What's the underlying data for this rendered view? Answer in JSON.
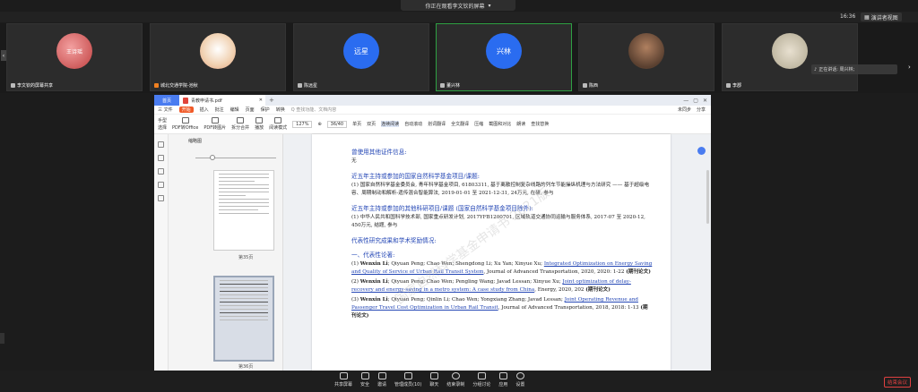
{
  "banner": {
    "text": "你正在观看李文钦的屏幕"
  },
  "topbar": {
    "time": "16:36",
    "layout_label": "演讲者视图"
  },
  "participants": [
    {
      "name": "李文钦的屏幕共享",
      "avatar": "photo",
      "avatar_text": "王诗瑶"
    },
    {
      "name": "城北交通学院-池秋",
      "avatar": "photo",
      "avatar_text": ""
    },
    {
      "name": "陈远星",
      "avatar": "initials",
      "avatar_text": "远星"
    },
    {
      "name": "董兴林",
      "avatar": "initials",
      "avatar_text": "兴林"
    },
    {
      "name": "陈西",
      "avatar": "photo",
      "avatar_text": ""
    },
    {
      "name": "李郡",
      "avatar": "photo",
      "avatar_text": ""
    }
  ],
  "speaking": {
    "text": "正在讲话: 周兴林;"
  },
  "wps": {
    "home_tab": "首页",
    "doc_tab": "青教申请书.pdf",
    "menus": [
      "三 文件",
      "开始",
      "插入",
      "批注",
      "编辑",
      "页面",
      "保护",
      "转换"
    ],
    "search_hint": "Q 查找功能、文档内容",
    "menu_right": [
      "未同步",
      "分享"
    ],
    "tools_left": [
      "手型",
      "选择"
    ],
    "tools": [
      "PDF转Office",
      "PDF转图片",
      "拆分合并",
      "播放",
      "阅读模式"
    ],
    "zoom": "127%",
    "page": "36/40",
    "tools_right": [
      "单页",
      "双页",
      "连续阅读",
      "自动滚动",
      "划词翻译",
      "全文翻译",
      "压缩",
      "截图和对比",
      "朗读",
      "查找替换"
    ],
    "thumb_title": "缩略图",
    "thumb_labels": [
      "第35页",
      "第36页"
    ]
  },
  "doc": {
    "h1": "曾使用其他证件信息:",
    "h1_val": "无",
    "h2": "近五年主持或参加的国家自然科学基金项目/课题:",
    "p2": "(1) 国家自然科学基金委员会, 青年科学基金项目, 61803311, 基于离散控制复杂线路的列车节能操纵机理与方法研究 —— 基于超级电容、周期制动和解析-遗传混合智能算法, 2019-01-01 至 2021-12-31, 24万元, 在研, 参与",
    "h3": "近五年主持或参加的其他科研项目/课题 (国家自然科学基金项目除外):",
    "p3": "(1) 中华人民共和国科学技术部, 国家重点研发计划, 2017YFB1200701, 区域轨道交通协同运输与服务体系, 2017-07 至 2020-12, 450万元, 结题, 参与",
    "h4": "代表性研究成果和学术奖励情况:",
    "h5": "一、代表性论著:",
    "refs": [
      {
        "pre": "(1) ",
        "author": "Wenxin Li",
        "rest": "; Qiyuan Peng; Chao Wen; Shengdong Li; Xu Yan; Xinyue Xu; ",
        "title": "Integrated Optimization on Energy Saving and Quality of Service of Urban Rail Transit System",
        "venue": ", Journal of Advanced Transportation, 2020, 2020: 1-22",
        "tag": "(期刊论文)"
      },
      {
        "pre": "(2) ",
        "author": "Wenxin Li",
        "rest": "; Qiyuan Peng; Chao Wen; Pengling Wang; Javad Lessan; Xinyue Xu; ",
        "title": "Joint optimization of delay-recovery and energy-saving in a metro system: A case study from China",
        "venue": ", Energy, 2020, 202",
        "tag": "(期刊论文)"
      },
      {
        "pre": "(3) ",
        "author": "Wenxin Li",
        "rest": "; Qiyuan Peng; Qinlin Li; Chao Wen; Yongxiang Zhang; Javad Lessan; ",
        "title": "Joint Operating Revenue and Passenger Travel Cost Optimization in Urban Rail Transit",
        "venue": ", Journal of Advanced Transportation, 2018, 2018: 1-13",
        "tag": "(期刊论文)"
      }
    ],
    "watermark": "国家自然科学基金申请书 2021版"
  },
  "bottom": {
    "buttons": [
      "共享屏幕",
      "安全",
      "邀请",
      "管理成员(10)",
      "聊天",
      "结束录制",
      "分组讨论",
      "应用",
      "设置"
    ],
    "end_label": "结束会议"
  }
}
